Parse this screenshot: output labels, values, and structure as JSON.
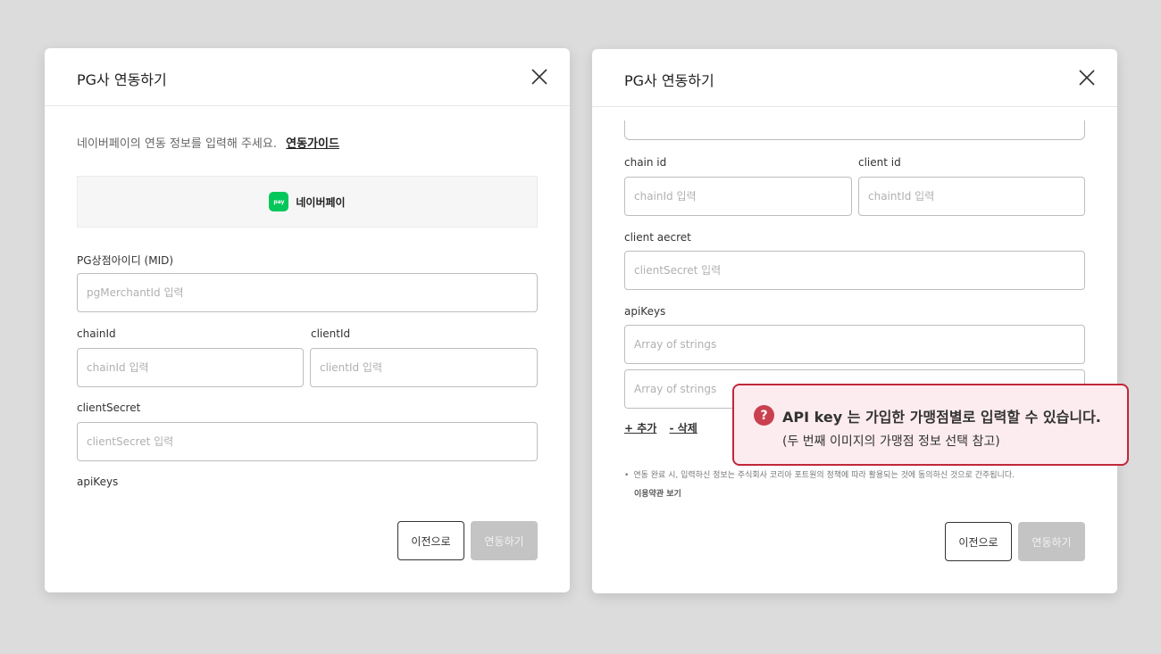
{
  "left_modal": {
    "title": "PG사 연동하기",
    "intro_text": "네이버페이의 연동 정보를 입력해 주세요.",
    "guide_link": "연동가이드",
    "pg_logo_text": "pay",
    "pg_name": "네이버페이",
    "fields": {
      "mid_label": "PG상점아이디 (MID)",
      "mid_placeholder": "pgMerchantId 입력",
      "chain_label": "chainId",
      "chain_placeholder": "chainId 입력",
      "client_label": "clientId",
      "client_placeholder": "clientId 입력",
      "secret_label": "clientSecret",
      "secret_placeholder": "clientSecret 입력",
      "apikeys_label": "apiKeys"
    },
    "prev_button": "이전으로",
    "submit_button": "연동하기"
  },
  "right_modal": {
    "title": "PG사 연동하기",
    "fields": {
      "chain_label": "chain id",
      "chain_placeholder": "chainId 입력",
      "client_label": "client id",
      "client_placeholder": "chaintId 입력",
      "secret_label": "client aecret",
      "secret_placeholder": "clientSecret 입력",
      "apikeys_label": "apiKeys",
      "apikey1_placeholder": "Array of strings",
      "apikey2_placeholder": "Array of strings"
    },
    "add_label": "+ 추가",
    "delete_label": "- 삭제",
    "notice_bullet": "•",
    "notice_text": "연동 완료 시, 입력하신 정보는 주식회사 코리아 포트원의 정책에 따라 활용되는 것에 동의하신 것으로 간주됩니다.",
    "terms_link": "이용약관 보기",
    "prev_button": "이전으로",
    "submit_button": "연동하기"
  },
  "tooltip": {
    "icon_glyph": "?",
    "title": "API key 는 가입한 가맹점별로 입력할 수 있습니다.",
    "subtitle": "(두 번째 이미지의 가맹점 정보 선택 참고)"
  }
}
